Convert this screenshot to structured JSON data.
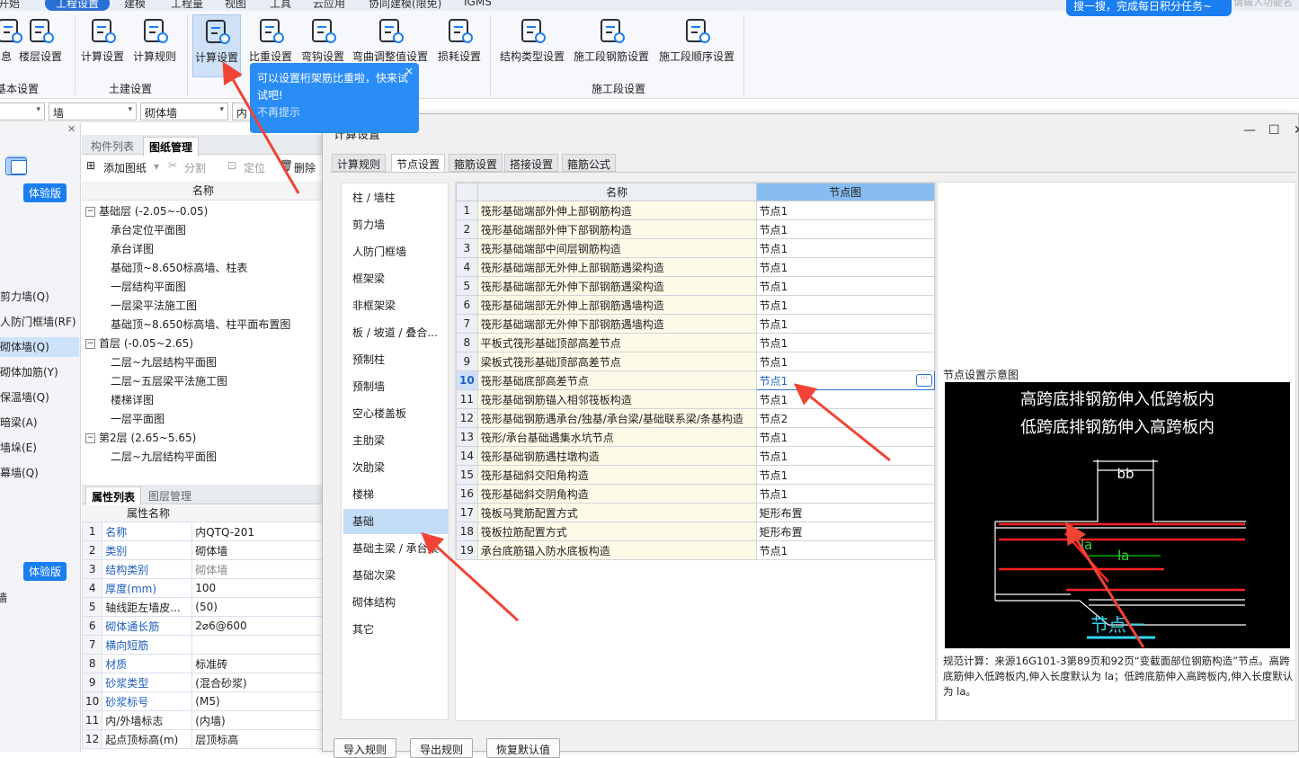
{
  "menubar": {
    "items": [
      "开始",
      "工程设置",
      "建模",
      "工程量",
      "视图",
      "工具",
      "云应用",
      "协同建模(限免)",
      "IGMS"
    ],
    "active_index": 1
  },
  "ribbon": {
    "buttons": [
      {
        "label": "息",
        "icon": "info-icon"
      },
      {
        "label": "楼层设置",
        "icon": "floor-settings-icon"
      },
      {
        "label": "计算设置",
        "icon": "calc-settings-icon"
      },
      {
        "label": "计算规则",
        "icon": "calc-rules-icon"
      },
      {
        "label": "计算设置",
        "icon": "calc-settings-icon",
        "selected": true
      },
      {
        "label": "比重设置",
        "icon": "density-settings-icon"
      },
      {
        "label": "弯钩设置",
        "icon": "hook-settings-icon"
      },
      {
        "label": "弯曲调整值设置",
        "icon": "bend-adjust-icon"
      },
      {
        "label": "损耗设置",
        "icon": "loss-settings-icon"
      },
      {
        "label": "结构类型设置",
        "icon": "structure-type-icon"
      },
      {
        "label": "施工段钢筋设置",
        "icon": "segment-rebar-icon"
      },
      {
        "label": "施工段顺序设置",
        "icon": "segment-order-icon"
      }
    ],
    "groups": [
      "基本设置",
      "土建设置",
      "施工段设置"
    ],
    "search_pill": "搜一搜，完成每日积分任务~",
    "search_placeholder": "请输入功能名"
  },
  "toolbar_row": {
    "select1": "",
    "select2": "墙",
    "select3": "砌体墙",
    "select4": "内"
  },
  "left_panel": {
    "badge": "体验版",
    "items": [
      "剪力墙(Q)",
      "人防门框墙(RF)",
      "砌体墙(Q)",
      "砌体加筋(Y)",
      "保温墙(Q)",
      "暗梁(A)",
      "墙垛(E)",
      "幕墙(Q)"
    ],
    "selected_index": 2,
    "badge2": "体验版",
    "bottom_item": "墙"
  },
  "tree_panel": {
    "tabs": [
      "构件列表",
      "图纸管理"
    ],
    "active_tab": 1,
    "toolbar": [
      "添加图纸",
      "分割",
      "定位",
      "删除"
    ],
    "column": "名称",
    "rows": [
      {
        "text": "基础层 (-2.05~-0.05)",
        "level": 0,
        "exp": "−"
      },
      {
        "text": "承台定位平面图",
        "level": 1
      },
      {
        "text": "承台详图",
        "level": 1
      },
      {
        "text": "基础顶~8.650标高墙、柱表",
        "level": 1
      },
      {
        "text": "一层结构平面图",
        "level": 1
      },
      {
        "text": "一层梁平法施工图",
        "level": 1
      },
      {
        "text": "基础顶~8.650标高墙、柱平面布置图",
        "level": 1
      },
      {
        "text": "首层 (-0.05~2.65)",
        "level": 0,
        "exp": "−"
      },
      {
        "text": "二层~九层结构平面图",
        "level": 1
      },
      {
        "text": "二层~五层梁平法施工图",
        "level": 1
      },
      {
        "text": "楼梯详图",
        "level": 1
      },
      {
        "text": "一层平面图",
        "level": 1
      },
      {
        "text": "第2层 (2.65~5.65)",
        "level": 0,
        "exp": "−"
      },
      {
        "text": "二层~九层结构平面图",
        "level": 1
      }
    ]
  },
  "prop_panel": {
    "tabs": [
      "属性列表",
      "图层管理"
    ],
    "active_tab": 0,
    "header": "属性名称",
    "rows": [
      {
        "n": "1",
        "k": "名称",
        "v": "内QTQ-201",
        "blue": true
      },
      {
        "n": "2",
        "k": "类别",
        "v": "砌体墙",
        "blue": true
      },
      {
        "n": "3",
        "k": "结构类别",
        "v": "砌体墙",
        "blue": true,
        "gray": true
      },
      {
        "n": "4",
        "k": "厚度(mm)",
        "v": "100",
        "blue": true
      },
      {
        "n": "5",
        "k": "轴线距左墙皮...",
        "v": "(50)",
        "blue": false
      },
      {
        "n": "6",
        "k": "砌体通长筋",
        "v": "2⌀6@600",
        "blue": true
      },
      {
        "n": "7",
        "k": "横向短筋",
        "v": "",
        "blue": true
      },
      {
        "n": "8",
        "k": "材质",
        "v": "标准砖",
        "blue": true
      },
      {
        "n": "9",
        "k": "砂浆类型",
        "v": "(混合砂浆)",
        "blue": true
      },
      {
        "n": "10",
        "k": "砂浆标号",
        "v": "(M5)",
        "blue": true
      },
      {
        "n": "11",
        "k": "内/外墙标志",
        "v": "(内墙)",
        "blue": false
      },
      {
        "n": "12",
        "k": "起点顶标高(m)",
        "v": "层顶标高",
        "blue": false
      }
    ]
  },
  "callout": {
    "text": "可以设置桁架筋比重啦，快来试试吧!",
    "dismiss": "不再提示",
    "close": "×"
  },
  "dialog": {
    "title": "计算设置",
    "tabs": [
      "计算规则",
      "节点设置",
      "箍筋设置",
      "搭接设置",
      "箍筋公式"
    ],
    "active_tab": 1,
    "categories": [
      "柱 / 墙柱",
      "剪力墙",
      "人防门框墙",
      "框架梁",
      "非框架梁",
      "板 / 坡道 / 叠合...",
      "预制柱",
      "预制墙",
      "空心楼盖板",
      "主肋梁",
      "次肋梁",
      "楼梯",
      "基础",
      "基础主梁 / 承台梁",
      "基础次梁",
      "砌体结构",
      "其它"
    ],
    "selected_category": 12,
    "grid_headers": [
      "名称",
      "节点图"
    ],
    "rows": [
      {
        "n": "1",
        "name": "筏形基础端部外伸上部钢筋构造",
        "val": "节点1"
      },
      {
        "n": "2",
        "name": "筏形基础端部外伸下部钢筋构造",
        "val": "节点1"
      },
      {
        "n": "3",
        "name": "筏形基础端部中间层钢筋构造",
        "val": "节点1"
      },
      {
        "n": "4",
        "name": "筏形基础端部无外伸上部钢筋遇梁构造",
        "val": "节点1"
      },
      {
        "n": "5",
        "name": "筏形基础端部无外伸下部钢筋遇梁构造",
        "val": "节点1"
      },
      {
        "n": "6",
        "name": "筏形基础端部无外伸上部钢筋遇墙构造",
        "val": "节点1"
      },
      {
        "n": "7",
        "name": "筏形基础端部无外伸下部钢筋遇墙构造",
        "val": "节点1"
      },
      {
        "n": "8",
        "name": "平板式筏形基础顶部高差节点",
        "val": "节点1"
      },
      {
        "n": "9",
        "name": "梁板式筏形基础顶部高差节点",
        "val": "节点1"
      },
      {
        "n": "10",
        "name": "筏形基础底部高差节点",
        "val": "节点1"
      },
      {
        "n": "11",
        "name": "筏形基础钢筋锚入相邻筏板构造",
        "val": "节点1"
      },
      {
        "n": "12",
        "name": "筏形基础钢筋遇承台/独基/承台梁/基础联系梁/条基构造",
        "val": "节点2"
      },
      {
        "n": "13",
        "name": "筏形/承台基础遇集水坑节点",
        "val": "节点1"
      },
      {
        "n": "14",
        "name": "筏形基础钢筋遇柱墩构造",
        "val": "节点1"
      },
      {
        "n": "15",
        "name": "筏形基础斜交阳角构造",
        "val": "节点1"
      },
      {
        "n": "16",
        "name": "筏形基础斜交阴角构造",
        "val": "节点1"
      },
      {
        "n": "17",
        "name": "筏板马凳筋配置方式",
        "val": "矩形布置"
      },
      {
        "n": "18",
        "name": "筏板拉筋配置方式",
        "val": "矩形布置"
      },
      {
        "n": "19",
        "name": "承台底筋锚入防水底板构造",
        "val": "节点1"
      }
    ],
    "current_row": 9,
    "preview_title": "节点设置示意图",
    "diagram_text": {
      "line1": "高跨底排钢筋伸入低跨板内",
      "line2": "低跨底排钢筋伸入高跨板内",
      "bb": "bb",
      "la1": "la",
      "la2": "la",
      "node": "节点一"
    },
    "description": "规范计算：来源16G101-3第89页和92页“变截面部位钢筋构造”节点。高跨底筋伸入低跨板内,伸入长度默认为 la；低跨底筋伸入高跨板内,伸入长度默认为 la。",
    "bottom_buttons": [
      "导入规则",
      "导出规则",
      "恢复默认值"
    ],
    "window_controls": [
      "—",
      "☐",
      "✕"
    ]
  },
  "colors": {
    "accent": "#1a7ef0",
    "grid_header_hl": "#87bdf0",
    "row_name_bg": "#fdfbe8",
    "arrow": "#ef4436"
  }
}
